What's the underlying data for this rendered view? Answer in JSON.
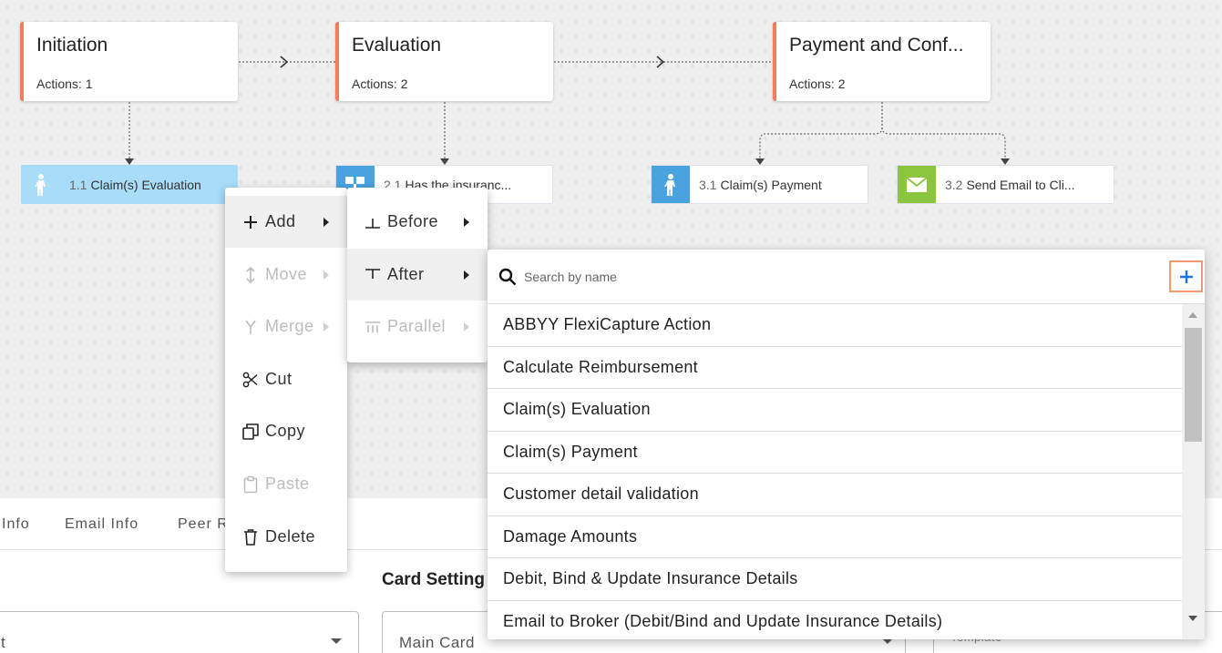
{
  "colors": {
    "stage_accent": "#f47c5e",
    "action_blue": "#4aa3df",
    "action_green": "#8cc63f",
    "selected_action_bg": "#a8dcf8",
    "add_button_border": "#f29a6b",
    "add_button_icon": "#1a73e8"
  },
  "stages": [
    {
      "title": "Initiation",
      "actions": "Actions: 1"
    },
    {
      "title": "Evaluation",
      "actions": "Actions: 2"
    },
    {
      "title": "Payment and Conf...",
      "actions": "Actions: 2"
    }
  ],
  "actions": [
    {
      "num": "1.1",
      "label": "Claim(s) Evaluation",
      "icon": "person-walking-icon"
    },
    {
      "num": "2.1",
      "label": "Has the insuranc...",
      "icon": "decision-icon"
    },
    {
      "num": "3.1",
      "label": "Claim(s) Payment",
      "icon": "person-walking-icon"
    },
    {
      "num": "3.2",
      "label": "Send Email to Cli...",
      "icon": "envelope-icon"
    }
  ],
  "context_menu": {
    "add": "Add",
    "move": "Move",
    "merge": "Merge",
    "cut": "Cut",
    "copy": "Copy",
    "paste": "Paste",
    "delete": "Delete"
  },
  "submenu": {
    "before": "Before",
    "after": "After",
    "parallel": "Parallel"
  },
  "search": {
    "placeholder": "Search by name"
  },
  "list_items": [
    "ABBYY FlexiCapture Action",
    "Calculate Reimbursement",
    "Claim(s) Evaluation",
    "Claim(s) Payment",
    "Customer detail validation",
    "Damage Amounts",
    "Debit, Bind & Update Insurance Details",
    "Email to Broker (Debit/Bind and Update Insurance Details)"
  ],
  "bottom_panel": {
    "tabs": [
      "Info",
      "Email Info",
      "Peer R"
    ],
    "heading": "Card Setting",
    "select_left_value": "t",
    "select_main_value": "Main Card",
    "select_right_value": "Template"
  }
}
